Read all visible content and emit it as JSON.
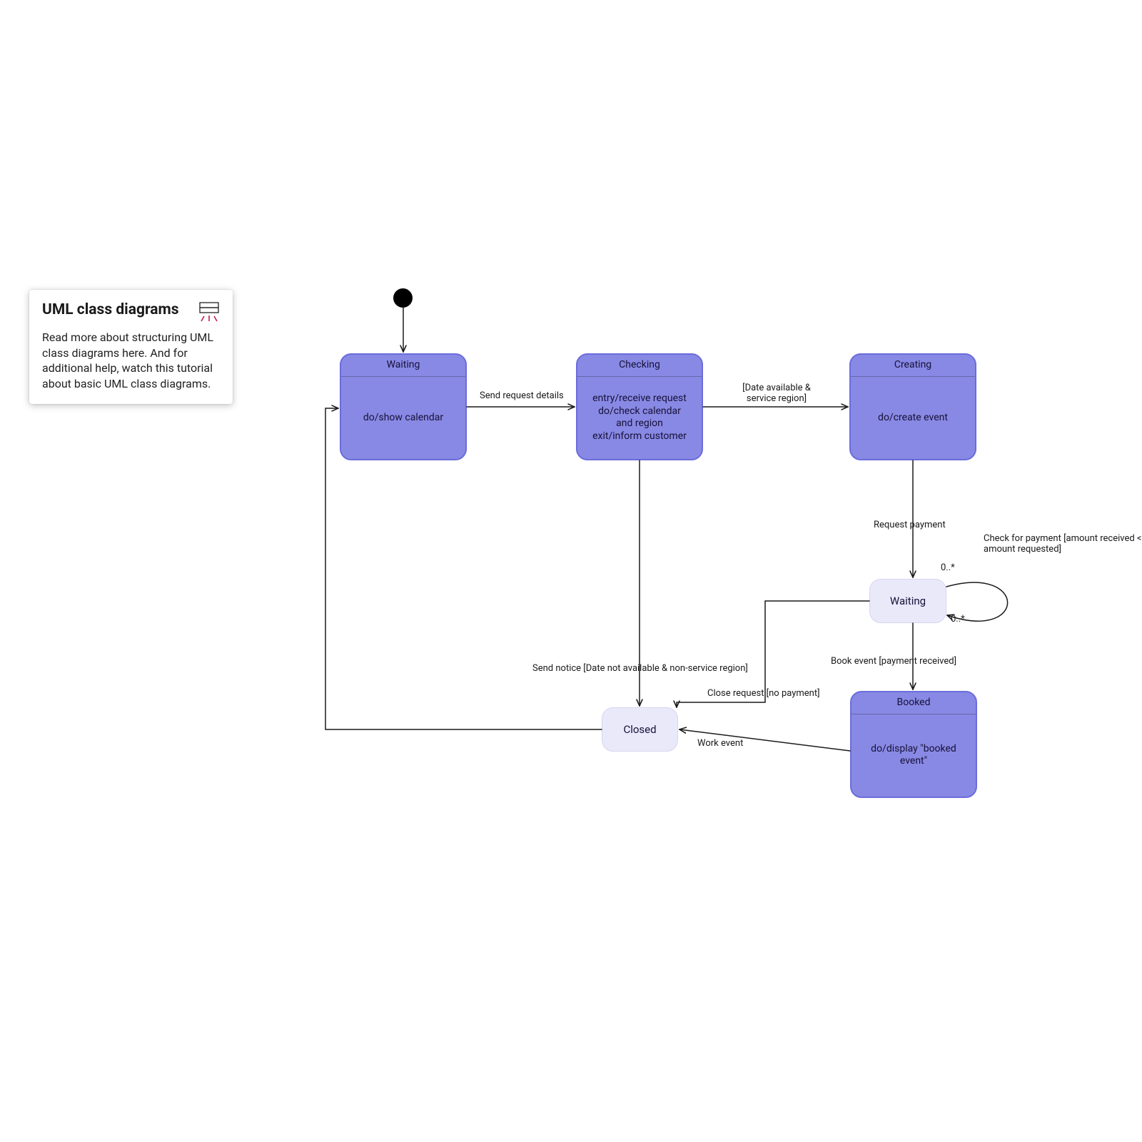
{
  "info_card": {
    "title": "UML class diagrams",
    "body": "Read more about structuring UML class diagrams here. And for additional help, watch this tutorial about basic UML class diagrams."
  },
  "states": {
    "waiting1": {
      "title": "Waiting",
      "action": "do/show calendar"
    },
    "checking": {
      "title": "Checking",
      "action_l1": "entry/receive request",
      "action_l2": "do/check calendar",
      "action_l3": "and region",
      "action_l4": "exit/inform customer"
    },
    "creating": {
      "title": "Creating",
      "action": "do/create event"
    },
    "waiting2": {
      "label": "Waiting"
    },
    "closed": {
      "label": "Closed"
    },
    "booked": {
      "title": "Booked",
      "action_l1": "do/display \"booked",
      "action_l2": "event\""
    }
  },
  "transitions": {
    "send_request_details": "Send request details",
    "date_available_l1": "[Date available &",
    "date_available_l2": "service region]",
    "request_payment": "Request payment",
    "check_payment_l1": "Check for payment [amount received <",
    "check_payment_l2": "amount requested]",
    "book_event": "Book event [payment received]",
    "send_notice": "Send notice [Date not available & non-service region]",
    "close_request": "Close request [no payment]",
    "work_event": "Work event"
  },
  "multiplicities": {
    "top": "0..*",
    "bottom": "0..*"
  }
}
